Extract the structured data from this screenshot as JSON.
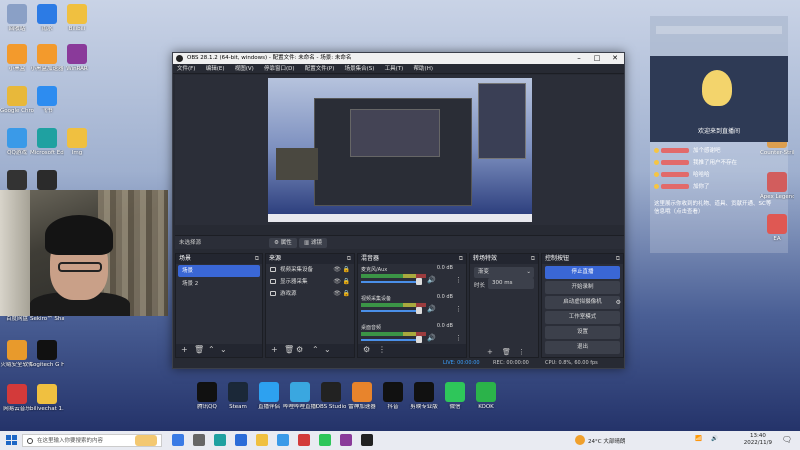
{
  "desktop": {
    "left_icons": [
      {
        "label": "回收站",
        "color": "#8aa0c6"
      },
      {
        "label": "雨水",
        "color": "#2c7be5"
      },
      {
        "label": "Bilibili",
        "color": "#f0c040"
      },
      {
        "label": "小黑盒",
        "color": "#f39a2c"
      },
      {
        "label": "小黑盒加速器",
        "color": "#f39a2c"
      },
      {
        "label": "WinRAR",
        "color": "#8a3a9a"
      },
      {
        "label": "Google Chrome",
        "color": "#e8b83a"
      },
      {
        "label": "飞书",
        "color": "#2d8cf0"
      },
      {
        "label": "QQ游戏",
        "color": "#3a9ae8"
      },
      {
        "label": "Microsoft Edge",
        "color": "#1fa1a1"
      },
      {
        "label": "Img",
        "color": "#f0c040"
      },
      {
        "label": "OBS",
        "color": "#333333"
      },
      {
        "label": "Sekiro",
        "color": "#2b2b2b"
      },
      {
        "label": "百度网盘",
        "color": "#5a8bd8"
      },
      {
        "label": "Sekiro™ Shadows...",
        "color": "#3a3a3a"
      },
      {
        "label": "火绒安全软件",
        "color": "#e89a2c"
      },
      {
        "label": "Logitech G HUB",
        "color": "#111111"
      },
      {
        "label": "网易云音乐",
        "color": "#d33a3a"
      },
      {
        "label": "bilivechat 1...",
        "color": "#f0c040"
      }
    ],
    "right_icons": [
      {
        "label": "Counter-Strike",
        "color": "#d58a2a"
      },
      {
        "label": "Apex Legends",
        "color": "#c93a3a"
      },
      {
        "label": "EA",
        "color": "#d8342e"
      }
    ],
    "center_icons": [
      {
        "label": "腾讯QQ",
        "color": "#111111"
      },
      {
        "label": "Steam",
        "color": "#1b2838"
      },
      {
        "label": "直播伴侣",
        "color": "#2da1f0"
      },
      {
        "label": "哔哩哔哩直播姬",
        "color": "#3aa7e0"
      },
      {
        "label": "OBS Studio",
        "color": "#222222"
      },
      {
        "label": "雷神加速器",
        "color": "#e8842c"
      },
      {
        "label": "抖音",
        "color": "#111111"
      },
      {
        "label": "剪映专业版",
        "color": "#111111"
      },
      {
        "label": "微信",
        "color": "#2ec65a"
      },
      {
        "label": "KOOK",
        "color": "#2bb34a"
      }
    ]
  },
  "obs": {
    "title": "OBS 28.1.2 (64-bit, windows) - 配置文件: 未命名 - 场景: 未命名",
    "menus": [
      "文件(F)",
      "编辑(E)",
      "视图(V)",
      "停靠窗口(D)",
      "配置文件(P)",
      "场景集合(S)",
      "工具(T)",
      "帮助(H)"
    ],
    "context": {
      "no_source": "未选择源",
      "properties": "属性",
      "filters": "滤镜"
    },
    "docks": {
      "scenes": {
        "title": "场景",
        "items": [
          "场景",
          "场景 2"
        ]
      },
      "sources": {
        "title": "来源",
        "items": [
          "视频采集设备",
          "显示器采集",
          "游戏源"
        ]
      },
      "mixer": {
        "title": "混音器",
        "channels": [
          {
            "name": "麦克风/Aux",
            "db": "0.0 dB"
          },
          {
            "name": "视频采集设备",
            "db": "0.0 dB"
          },
          {
            "name": "桌面音频",
            "db": "0.0 dB"
          }
        ]
      },
      "transitions": {
        "title": "转场特效",
        "type": "渐变",
        "duration_label": "时长",
        "duration": "300 ms"
      },
      "controls": {
        "title": "控制按钮",
        "buttons": [
          "停止直播",
          "开始录制",
          "启动虚拟摄像机",
          "工作室模式",
          "设置",
          "退出"
        ]
      }
    },
    "status": {
      "live": "LIVE: 00:00:00",
      "rec": "REC: 00:00:00",
      "cpu": "CPU: 0.8%, 60.00 fps"
    }
  },
  "chat": {
    "welcome": "欢迎来到直播间",
    "messages": [
      "加个感谢吧",
      "我推了用户不存在",
      "哈哈哈",
      "加你了"
    ],
    "tip": "这里展示你收到的礼物、道具、贡献开通、SC等信息哦（点击查看）"
  },
  "taskbar": {
    "search_placeholder": "在这里输入你要搜索的内容",
    "weather": "24°C 大部晴朗",
    "time": "13:40",
    "date": "2022/11/9",
    "apps_colors": [
      "#3a7be5",
      "#666666",
      "#1fa1a1",
      "#2b6cd8",
      "#f0c040",
      "#3a9ae8",
      "#d33a3a",
      "#2ec65a",
      "#8a3a9a",
      "#222222"
    ]
  }
}
